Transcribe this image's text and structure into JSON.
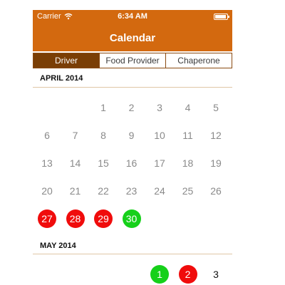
{
  "status": {
    "carrier": "Carrier",
    "time": "6:34 AM"
  },
  "nav": {
    "title": "Calendar"
  },
  "tabs": [
    {
      "label": "Driver",
      "active": true
    },
    {
      "label": "Food Provider",
      "active": false
    },
    {
      "label": "Chaperone",
      "active": false
    }
  ],
  "colors": {
    "accent": "#d3690f",
    "active_tab": "#7a3e05",
    "red": "#f00c0c",
    "green": "#16d01a"
  },
  "months": [
    {
      "title": "APRIL 2014",
      "days": [
        {
          "label": "1",
          "status": "normal"
        },
        {
          "label": "2",
          "status": "normal"
        },
        {
          "label": "3",
          "status": "normal"
        },
        {
          "label": "4",
          "status": "normal"
        },
        {
          "label": "5",
          "status": "normal"
        },
        {
          "label": "6",
          "status": "normal"
        },
        {
          "label": "7",
          "status": "normal"
        },
        {
          "label": "8",
          "status": "normal"
        },
        {
          "label": "9",
          "status": "normal"
        },
        {
          "label": "10",
          "status": "normal"
        },
        {
          "label": "11",
          "status": "normal"
        },
        {
          "label": "12",
          "status": "normal"
        },
        {
          "label": "13",
          "status": "normal"
        },
        {
          "label": "14",
          "status": "normal"
        },
        {
          "label": "15",
          "status": "normal"
        },
        {
          "label": "16",
          "status": "normal"
        },
        {
          "label": "17",
          "status": "normal"
        },
        {
          "label": "18",
          "status": "normal"
        },
        {
          "label": "19",
          "status": "normal"
        },
        {
          "label": "20",
          "status": "normal"
        },
        {
          "label": "21",
          "status": "normal"
        },
        {
          "label": "22",
          "status": "normal"
        },
        {
          "label": "23",
          "status": "normal"
        },
        {
          "label": "24",
          "status": "normal"
        },
        {
          "label": "25",
          "status": "normal"
        },
        {
          "label": "26",
          "status": "normal"
        },
        {
          "label": "27",
          "status": "red"
        },
        {
          "label": "28",
          "status": "red"
        },
        {
          "label": "29",
          "status": "red"
        },
        {
          "label": "30",
          "status": "green"
        }
      ]
    },
    {
      "title": "MAY 2014",
      "days": [
        {
          "label": "1",
          "status": "green"
        },
        {
          "label": "2",
          "status": "red"
        },
        {
          "label": "3",
          "status": "black"
        }
      ]
    }
  ]
}
